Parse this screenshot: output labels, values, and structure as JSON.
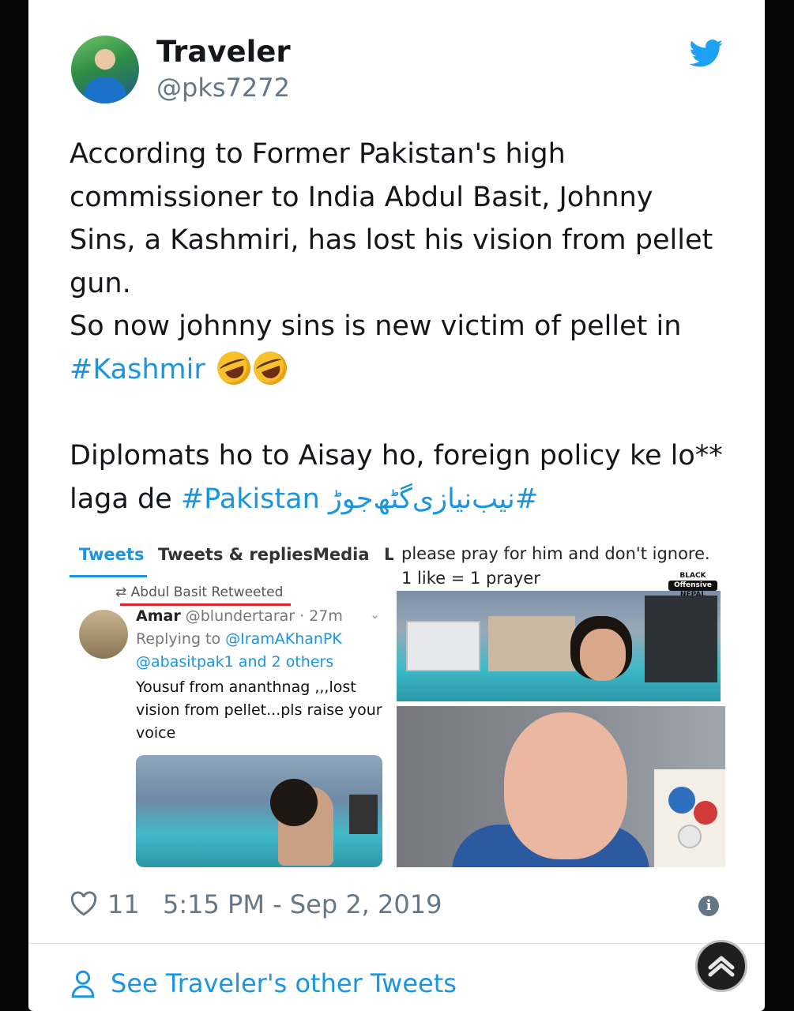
{
  "tweet": {
    "author_name": "Traveler",
    "author_handle": "@pks7272",
    "line1": "According to Former Pakistan's high",
    "line2": "commissioner to India Abdul Basit, Johnny",
    "line3": "Sins, a Kashmiri, has lost his vision from pellet",
    "line4": "gun.",
    "line5": "So now johnny sins is new victim of pellet in",
    "hashtag_kashmir": "#Kashmir",
    "line7": "Diplomats ho to Aisay ho, foreign policy ke lo**",
    "line8_prefix": "laga de",
    "hashtag_pakistan": "#Pakistan",
    "hashtag_urdu": "#نیب‌نیازی‌گٹھ‌جوڑ",
    "likes": "11",
    "timestamp": "5:15 PM - Sep 2, 2019",
    "see_other": "See Traveler's other Tweets"
  },
  "embedded_screenshot": {
    "tabs": [
      "Tweets",
      "Tweets & replies",
      "Media",
      "L"
    ],
    "retweet_label": "Abdul Basit Retweeted",
    "reply_author": "Amar",
    "reply_handle_time": "@blundertarar · 27m",
    "replying_prefix": "Replying to",
    "replying_to": "@IramAKhanPK",
    "replying_more": "@abasitpak1 and 2 others",
    "reply_text": "Yousuf from ananthnag ,,,lost vision from pellet...pls raise your voice"
  },
  "right_image": {
    "caption_line1": "please pray for him and don't ignore.",
    "caption_line2": "1 like = 1 prayer",
    "watermark_top": "BLACK",
    "watermark_mid": "Offensive",
    "watermark_bottom": "NEPAL"
  },
  "colors": {
    "link": "#1b95e0",
    "text": "#14171a",
    "muted": "#657786"
  }
}
